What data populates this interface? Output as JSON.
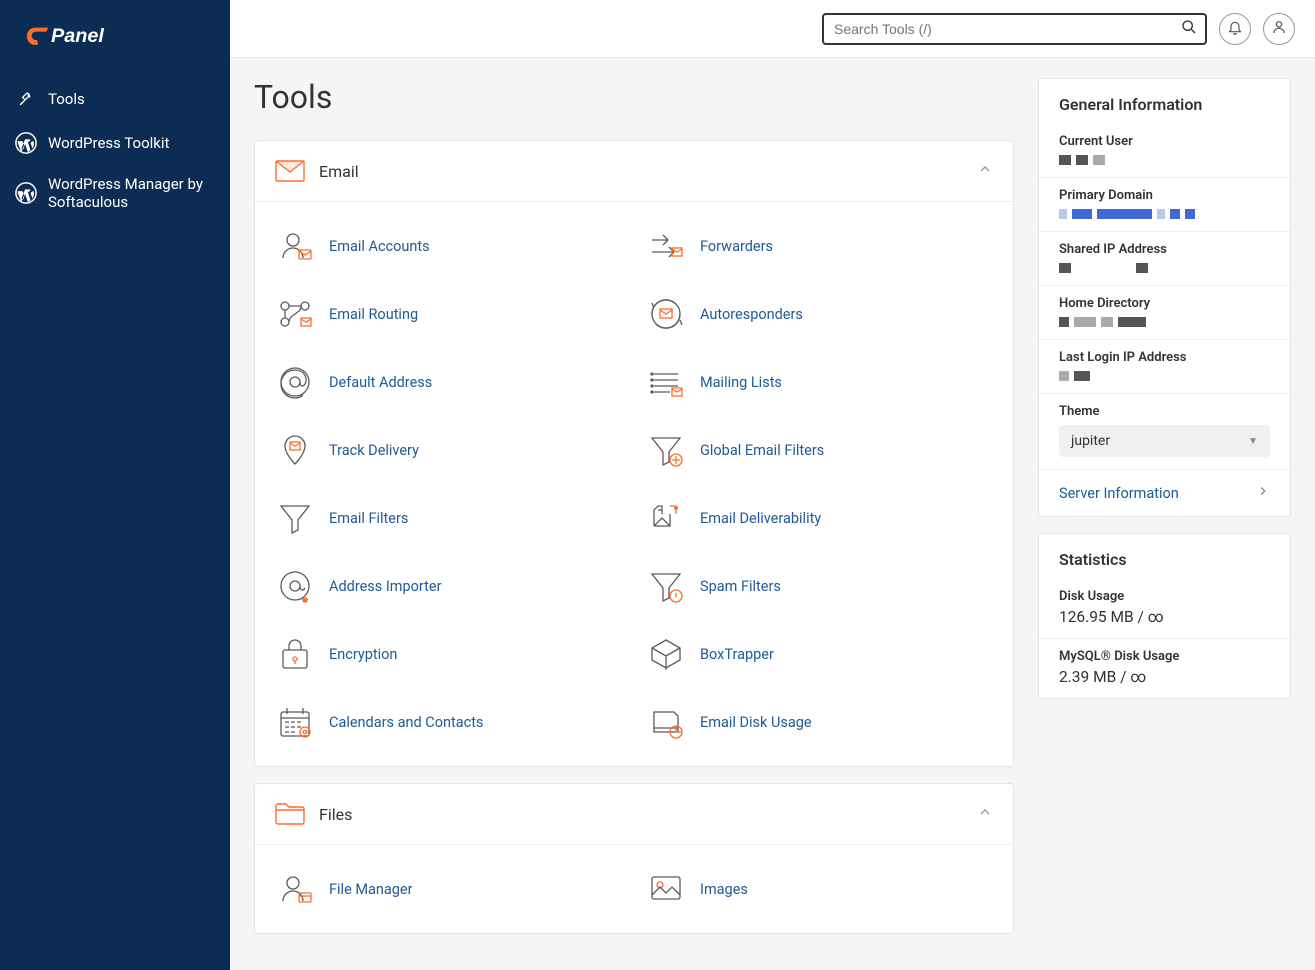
{
  "search": {
    "placeholder": "Search Tools (/)"
  },
  "sidebar": {
    "items": [
      {
        "label": "Tools"
      },
      {
        "label": "WordPress Toolkit"
      },
      {
        "label": "WordPress Manager by Softaculous"
      }
    ]
  },
  "page": {
    "title": "Tools"
  },
  "groups": [
    {
      "title": "Email",
      "items": [
        "Email Accounts",
        "Forwarders",
        "Email Routing",
        "Autoresponders",
        "Default Address",
        "Mailing Lists",
        "Track Delivery",
        "Global Email Filters",
        "Email Filters",
        "Email Deliverability",
        "Address Importer",
        "Spam Filters",
        "Encryption",
        "BoxTrapper",
        "Calendars and Contacts",
        "Email Disk Usage"
      ]
    },
    {
      "title": "Files",
      "items": [
        "File Manager",
        "Images"
      ]
    }
  ],
  "info": {
    "title": "General Information",
    "current_user_label": "Current User",
    "primary_domain_label": "Primary Domain",
    "shared_ip_label": "Shared IP Address",
    "home_dir_label": "Home Directory",
    "last_login_label": "Last Login IP Address",
    "theme_label": "Theme",
    "theme_value": "jupiter",
    "server_info": "Server Information"
  },
  "stats": {
    "title": "Statistics",
    "rows": [
      {
        "label": "Disk Usage",
        "value": "126.95 MB / ∞"
      },
      {
        "label": "MySQL® Disk Usage",
        "value": "2.39 MB / ∞"
      }
    ]
  }
}
